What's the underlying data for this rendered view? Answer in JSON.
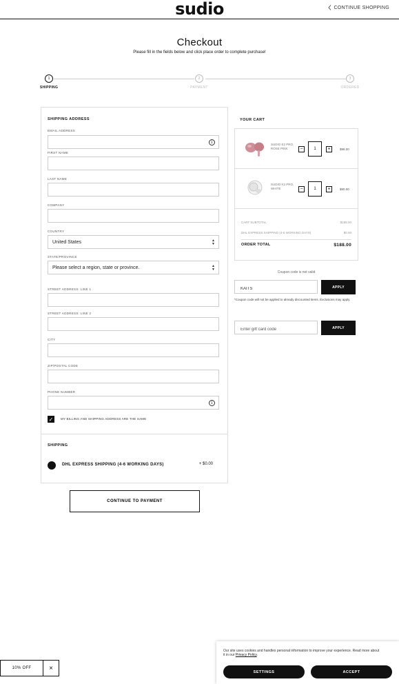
{
  "header": {
    "logo": "sudio",
    "continue_label": "CONTINUE SHOPPING"
  },
  "page": {
    "title": "Checkout",
    "subtitle": "Please fill in the fields below and click place order to complete purchase!"
  },
  "steps": [
    {
      "number": "1",
      "label": "SHIPPING",
      "active": true
    },
    {
      "number": "2",
      "label": "PAYMENT",
      "active": false
    },
    {
      "number": "3",
      "label": "ORDERED",
      "active": false
    }
  ],
  "shipping_form": {
    "heading": "SHIPPING ADDRESS",
    "email_label": "EMAIL ADDRESS",
    "first_name_label": "FIRST NAME",
    "last_name_label": "LAST NAME",
    "company_label": "COMPANY",
    "country_label": "COUNTRY",
    "country_value": "United States",
    "state_label": "STATE/PROVINCE",
    "state_value": "Please select a region, state or province.",
    "street1_label": "STREET ADDRESS: LINE 1",
    "street2_label": "STREET ADDRESS: LINE 2",
    "city_label": "CITY",
    "zip_label": "ZIP/POSTAL CODE",
    "phone_label": "PHONE NUMBER",
    "info_icon": "i",
    "billing_same_label": "MY BILLING AND SHIPPING ADDRESS ARE THE SAME",
    "billing_same_checked": true
  },
  "shipping_method": {
    "heading": "SHIPPING",
    "option_label": "DHL EXPRESS SHIPPING (4-6 WORKING DAYS)",
    "option_price": "+ $0.00"
  },
  "continue_button": "CONTINUE TO PAYMENT",
  "cart": {
    "title": "YOUR CART",
    "items": [
      {
        "name": "SUDIO E2 PRO, ROSE PINK",
        "qty": "1",
        "price": "$98.00",
        "color": "#d08f98"
      },
      {
        "name": "SUDIO K2 PRO, WHITE",
        "qty": "1",
        "price": "$90.00",
        "color": "#e8e8e8"
      }
    ],
    "subtotal_label": "CART SUBTOTAL",
    "subtotal_value": "$188.00",
    "shipping_label": "DHL EXPRESS SHIPPING (4-6 WORKING DAYS)",
    "shipping_value": "$0.00",
    "total_label": "ORDER TOTAL",
    "total_value": "$188.00"
  },
  "coupon": {
    "error": "Coupon code is not valid",
    "value": "KAITS",
    "apply_label": "APPLY",
    "note": "*Coupon code will not be applied to already discounted items. Exclusions may apply."
  },
  "gift_card": {
    "placeholder": "Enter gift card code",
    "apply_label": "APPLY"
  },
  "promo": {
    "label": "10% OFF",
    "close": "×"
  },
  "cookie": {
    "text": "Our site uses cookies and handles personal information to improve your experience. Read more about it in our",
    "link": "Privacy Policy",
    "settings_label": "SETTINGS",
    "accept_label": "ACCEPT"
  }
}
